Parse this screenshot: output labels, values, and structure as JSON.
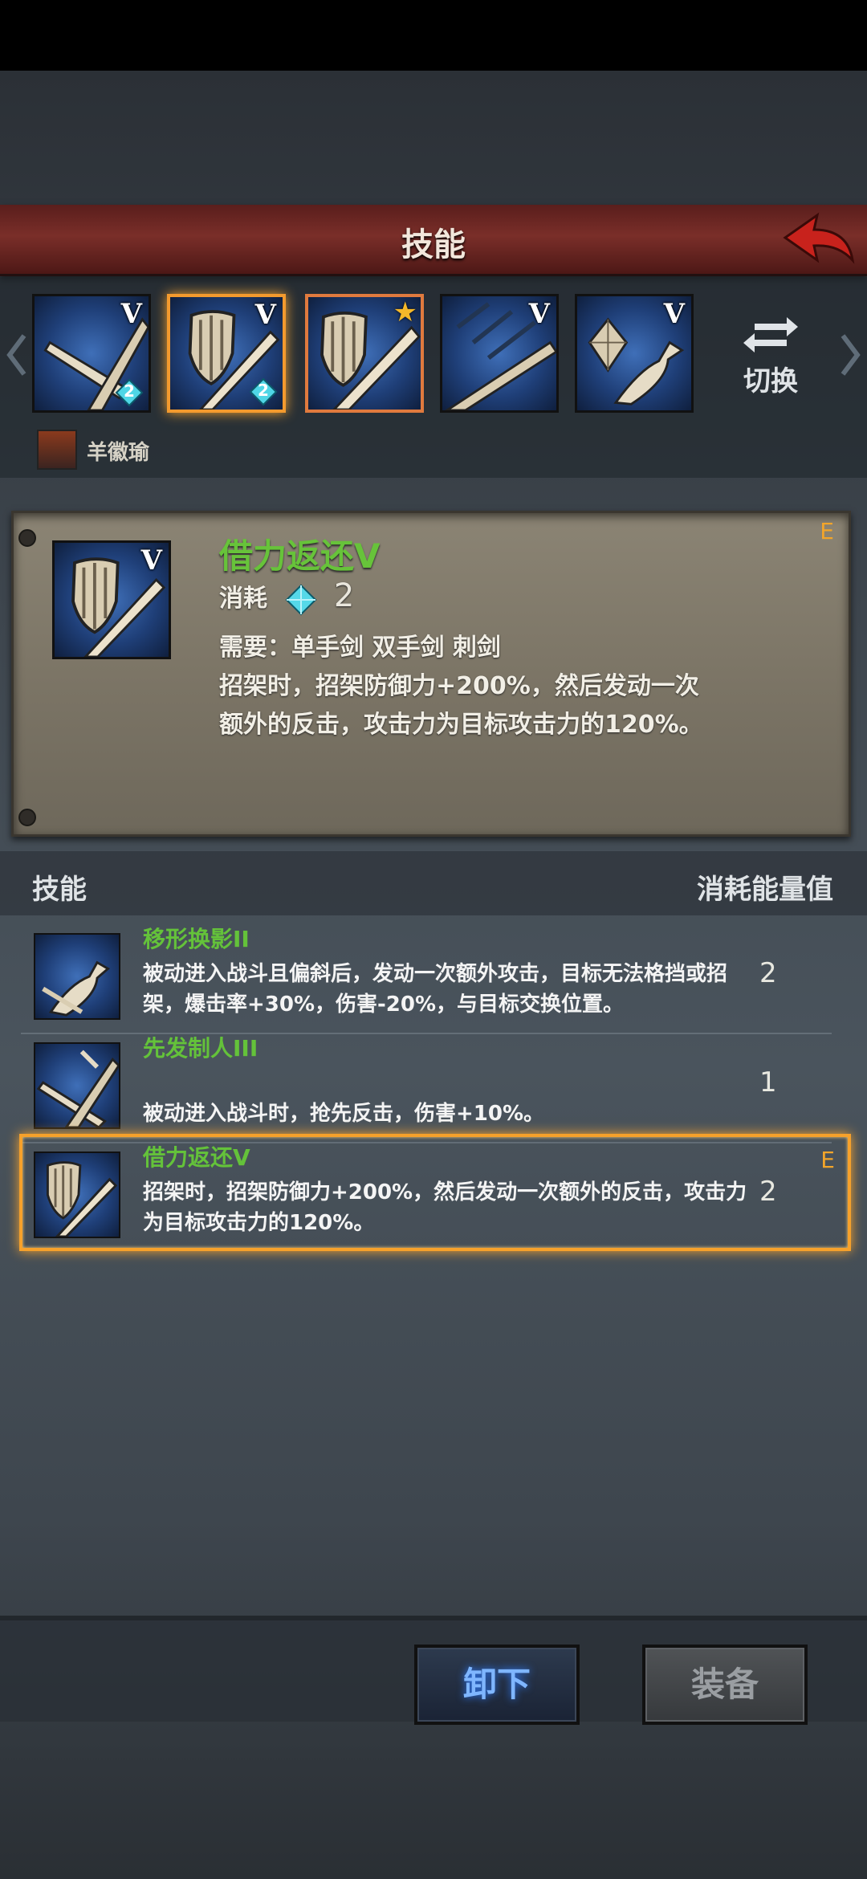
{
  "header": {
    "title": "技能"
  },
  "skill_slots": [
    {
      "roman": "V",
      "gem_count": "2",
      "star": false,
      "state": "normal"
    },
    {
      "roman": "V",
      "gem_count": "2",
      "star": false,
      "state": "selected"
    },
    {
      "roman": "",
      "gem_count": "",
      "star": true,
      "state": "active"
    },
    {
      "roman": "V",
      "gem_count": "",
      "star": false,
      "state": "normal"
    },
    {
      "roman": "V",
      "gem_count": "",
      "star": false,
      "state": "normal"
    }
  ],
  "switch": {
    "label": "切换"
  },
  "character": {
    "name": "羊徽瑜"
  },
  "detail": {
    "name": "借力返还V",
    "grade": "E",
    "icon_roman": "V",
    "cost_label": "消耗",
    "cost_value": "2",
    "requires": "需要：单手剑 双手剑 刺剑",
    "desc_line1": "招架时，招架防御力+200%，然后发动一次",
    "desc_line2": "额外的反击，攻击力为目标攻击力的120%。"
  },
  "list_header": {
    "left": "技能",
    "right": "消耗能量值"
  },
  "skills": [
    {
      "name": "移形换影II",
      "desc": "被动进入战斗且偏斜后，发动一次额外攻击，目标无法格挡或招架，爆击率+30%，伤害-20%，与目标交换位置。",
      "cost": "2",
      "grade": ""
    },
    {
      "name": "先发制人III",
      "desc": "被动进入战斗时，抢先反击，伤害+10%。",
      "cost": "1",
      "grade": ""
    },
    {
      "name": "借力返还V",
      "desc": "招架时，招架防御力+200%，然后发动一次额外的反击，攻击力为目标攻击力的120%。",
      "cost": "2",
      "grade": "E"
    }
  ],
  "buttons": {
    "unequip": "卸下",
    "equip": "装备"
  },
  "colors": {
    "accent_green": "#64c23a",
    "selection_orange": "#f6a12b",
    "title_red": "#7a2e29"
  },
  "icons": [
    "back-arrow-icon",
    "diamond-gem-icon",
    "star-icon",
    "swap-arrows-icon",
    "shield-sword-icon",
    "crossed-blades-icon",
    "bird-icon",
    "chevron-left-icon",
    "chevron-right-icon"
  ]
}
